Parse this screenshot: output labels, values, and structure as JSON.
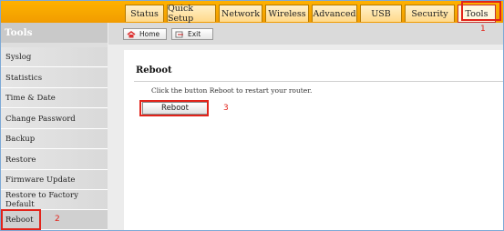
{
  "nav": {
    "tabs": [
      {
        "label": "Status"
      },
      {
        "label": "Quick Setup"
      },
      {
        "label": "Network"
      },
      {
        "label": "Wireless"
      },
      {
        "label": "Advanced"
      },
      {
        "label": "USB"
      },
      {
        "label": "Security"
      },
      {
        "label": "Tools"
      }
    ],
    "active": "Tools"
  },
  "sidebar": {
    "title": "Tools",
    "items": [
      {
        "label": "Syslog"
      },
      {
        "label": "Statistics"
      },
      {
        "label": "Time & Date"
      },
      {
        "label": "Change Password"
      },
      {
        "label": "Backup"
      },
      {
        "label": "Restore"
      },
      {
        "label": "Firmware Update"
      },
      {
        "label": "Restore to Factory Default"
      },
      {
        "label": "Reboot"
      }
    ],
    "active": "Reboot"
  },
  "toolbar": {
    "home_label": "Home",
    "exit_label": "Exit"
  },
  "main": {
    "title": "Reboot",
    "description": "Click the button Reboot to restart your router.",
    "reboot_label": "Reboot"
  },
  "annotations": {
    "tools_step": "1",
    "sidebar_step": "2",
    "button_step": "3"
  },
  "colors": {
    "topbar": "#f7a800",
    "highlight": "#e2231a",
    "panel": "#ffffff",
    "sidebar": "#dedede"
  }
}
